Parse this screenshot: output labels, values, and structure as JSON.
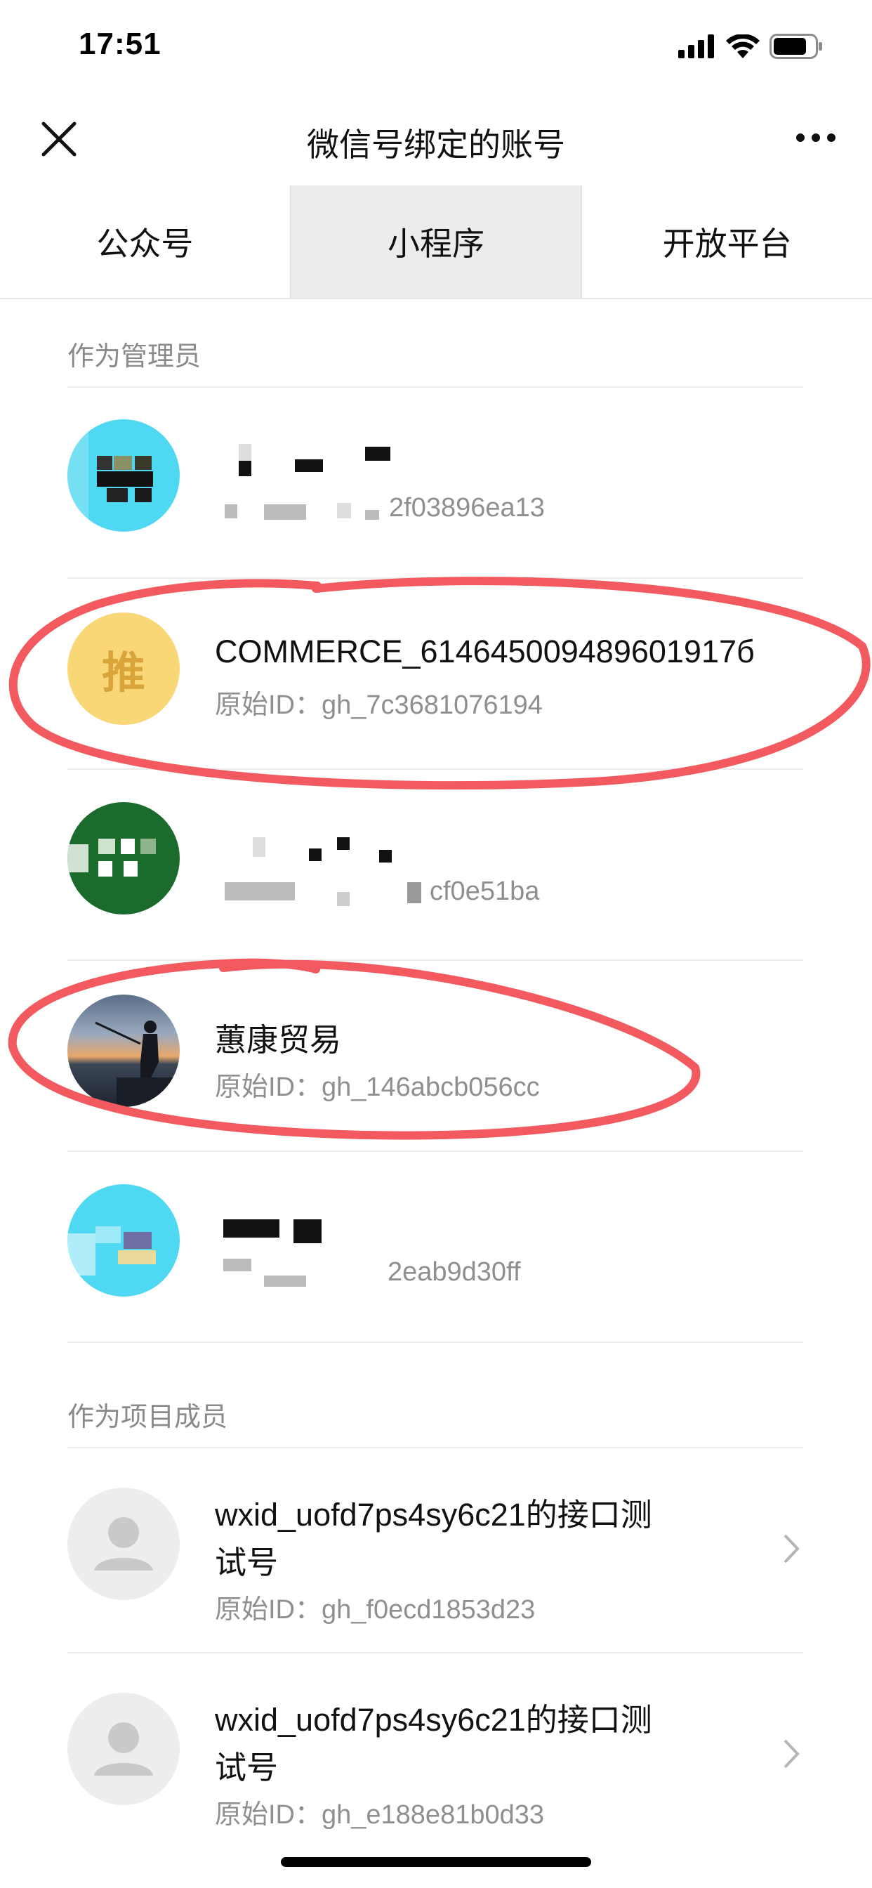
{
  "status_bar": {
    "time": "17:51"
  },
  "nav": {
    "title": "微信号绑定的账号"
  },
  "tabs": [
    {
      "label": "公众号",
      "active": false
    },
    {
      "label": "小程序",
      "active": true
    },
    {
      "label": "开放平台",
      "active": false
    }
  ],
  "admin_section": {
    "title": "作为管理员",
    "items": [
      {
        "name": "",
        "id_suffix": "2f03896ea13",
        "avatar": "pixelated-cyan"
      },
      {
        "name": "COMMERCE_614645009489601917б",
        "id": "原始ID：gh_7c3681076194",
        "avatar_char": "推"
      },
      {
        "name": "",
        "id_suffix": "cf0e51ba",
        "avatar": "pixelated-green"
      },
      {
        "name": "蕙康贸易",
        "id": "原始ID：gh_146abcb056cc",
        "avatar": "photo-fisherman-sunset"
      },
      {
        "name": "",
        "id_suffix": "2eab9d30ff",
        "avatar": "pixelated-cyan-2"
      }
    ]
  },
  "member_section": {
    "title": "作为项目成员",
    "items": [
      {
        "name_line1": "wxid_uofd7ps4sy6c21的接口测",
        "name_line2": "试号",
        "id": "原始ID：gh_f0ecd1853d23"
      },
      {
        "name_line1": "wxid_uofd7ps4sy6c21的接口测",
        "name_line2": "试号",
        "id": "原始ID：gh_e188e81b0d33"
      }
    ]
  },
  "colors": {
    "annotation": "#f25a5f",
    "muted": "#8f8f8f",
    "tab_active_bg": "#ececec"
  },
  "icons": [
    "signal-icon",
    "wifi-icon",
    "battery-icon",
    "close-icon",
    "more-icon",
    "chevron-right-icon",
    "default-avatar-icon"
  ]
}
